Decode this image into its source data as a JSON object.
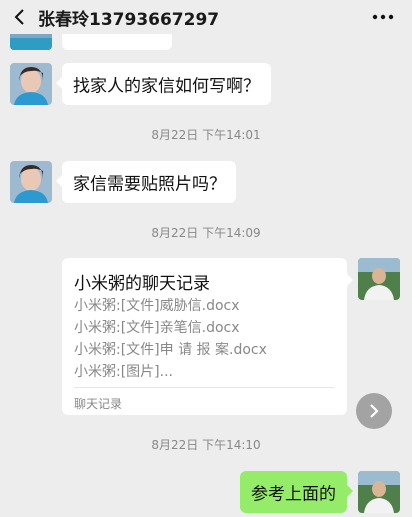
{
  "header": {
    "title": "张春玲13793667297",
    "back_icon": "chevron-left-icon",
    "more_icon": "more-dots-icon"
  },
  "messages": [
    {
      "side": "left",
      "text": "找家人的家信如何写啊？"
    },
    {
      "time": "8月22日 下午14:01"
    },
    {
      "side": "left",
      "text": "家信需要贴照片吗？"
    },
    {
      "time": "8月22日 下午14:09"
    },
    {
      "side": "right",
      "type": "chat-record",
      "title": "小米粥的聊天记录",
      "lines": [
        "小米粥:[文件]威胁信.docx",
        "小米粥:[文件]亲笔信.docx",
        "小米粥:[文件]申 请 报 案.docx",
        "小米粥:[图片]..."
      ],
      "footer": "聊天记录",
      "forward_icon": "forward-arrow-icon"
    },
    {
      "time": "8月22日 下午14:10"
    },
    {
      "side": "right",
      "text": "参考上面的"
    }
  ],
  "colors": {
    "background": "#ededed",
    "bubble_self": "#95ec69",
    "bubble_other": "#ffffff"
  }
}
